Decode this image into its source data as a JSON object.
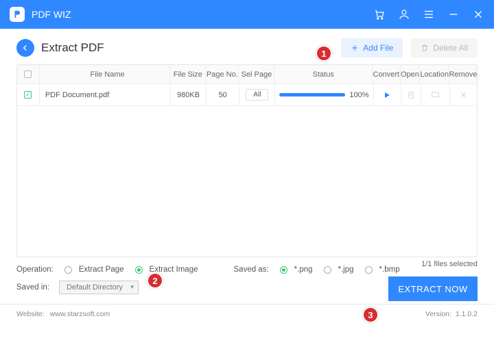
{
  "app": {
    "title": "PDF WIZ"
  },
  "header": {
    "page_title": "Extract PDF",
    "add_file": "Add File",
    "delete_all": "Delete All"
  },
  "table": {
    "cols": {
      "name": "File Name",
      "size": "File Size",
      "page": "Page No.",
      "sel": "Sel Page",
      "status": "Status",
      "convert": "Convert",
      "open": "Open",
      "location": "Location",
      "remove": "Remove"
    },
    "rows": [
      {
        "name": "PDF Document.pdf",
        "size": "980KB",
        "page": "50",
        "sel": "All",
        "status_pct": "100%"
      }
    ]
  },
  "options": {
    "files_selected": "1/1 files selected",
    "operation_label": "Operation:",
    "operation_items": {
      "page": "Extract Page",
      "image": "Extract Image"
    },
    "saved_as_label": "Saved as:",
    "saved_as_items": {
      "png": "*.png",
      "jpg": "*.jpg",
      "bmp": "*.bmp"
    },
    "saved_in_label": "Saved in:",
    "saved_in_value": "Default Directory",
    "extract_btn": "EXTRACT NOW"
  },
  "footer": {
    "website_label": "Website:",
    "website_url": "www.starzsoft.com",
    "version_label": "Version:",
    "version_value": "1.1.0.2"
  },
  "callouts": {
    "c1": "1",
    "c2": "2",
    "c3": "3"
  }
}
